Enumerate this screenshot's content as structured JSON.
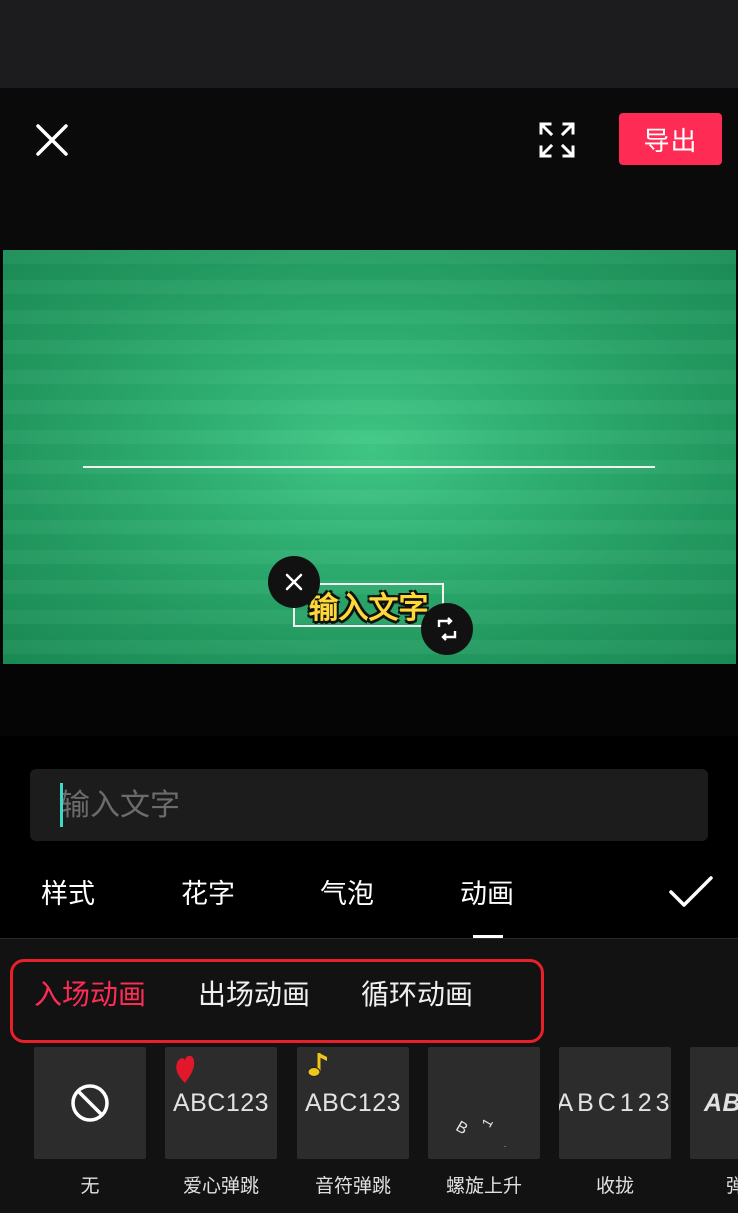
{
  "header": {
    "export_label": "导出"
  },
  "preview": {
    "sticker_text": "输入文字"
  },
  "input": {
    "placeholder": "输入文字"
  },
  "tabs": {
    "items": [
      "样式",
      "花字",
      "气泡",
      "动画"
    ],
    "active": "动画"
  },
  "animation_types": {
    "items": [
      "入场动画",
      "出场动画",
      "循环动画"
    ],
    "active": "入场动画"
  },
  "effects": [
    {
      "name": "无",
      "thumb": "none-icon"
    },
    {
      "name": "爱心弹跳",
      "thumb": "ABC123"
    },
    {
      "name": "音符弹跳",
      "thumb": "ABC123"
    },
    {
      "name": "螺旋上升",
      "thumb": ""
    },
    {
      "name": "收拢",
      "thumb": "ABC123"
    },
    {
      "name": "弹",
      "thumb": "ABC"
    }
  ],
  "colors": {
    "accent": "#fe2c55",
    "highlight_frame": "#e8202a",
    "caret": "#41d7c7",
    "video_green": "#2fb072",
    "sticker_text": "#ffd93a"
  },
  "icons": [
    "close-icon",
    "fullscreen-icon",
    "delete-sticker-icon",
    "rotate-sticker-icon",
    "check-icon",
    "no-symbol-icon",
    "heart-icon",
    "music-note-icon"
  ]
}
